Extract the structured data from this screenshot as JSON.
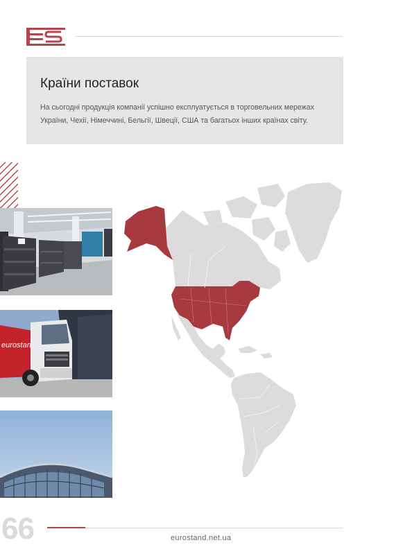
{
  "header": {
    "logo_icon": "eurostand-es-logo-icon"
  },
  "info": {
    "title": "Країни поставок",
    "text": "На сьогодні продукція компанії успішно експлуатується в торговельних мережах України, Чехії, Німеччині, Бельгії, Швеції, США та багатьох інших країнах світу."
  },
  "photos": {
    "truck_text": "eurostand"
  },
  "map": {
    "highlight_color": "#a83a3f",
    "base_color": "#dcdcdc",
    "highlighted_countries": [
      "Alaska (USA)",
      "USA"
    ]
  },
  "footer": {
    "page_number": "66",
    "website": "eurostand.net.ua"
  },
  "colors": {
    "accent": "#b8454b",
    "box_bg": "#e6e6e6"
  }
}
